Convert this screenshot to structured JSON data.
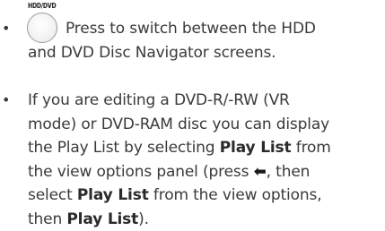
{
  "button_label": "HDD/DVD",
  "bullet_char": "•",
  "bullet1": {
    "line1": "Press to switch between the HDD",
    "line2": "and DVD Disc Navigator screens."
  },
  "bullet2": {
    "line1": "If you are editing a DVD-R/-RW (VR",
    "line2": "mode) or DVD-RAM disc you can display",
    "line3_pre": "the Play List by selecting ",
    "line3_bold": "Play List",
    "line3_post": " from",
    "line4_pre": "the view options panel (press ",
    "line4_arrow": "⬅",
    "line4_post": ", then",
    "line5_pre": "select ",
    "line5_bold": "Play List",
    "line5_post": " from the view options,",
    "line6_pre": "then ",
    "line6_bold": "Play List",
    "line6_post": ")."
  }
}
